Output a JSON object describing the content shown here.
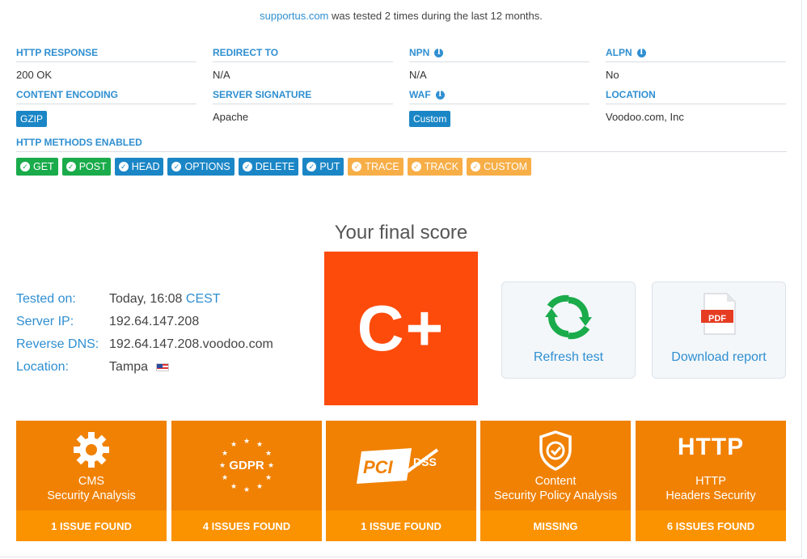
{
  "header": {
    "domain_link": "supportus.com",
    "tested_text": "was tested 2 times during the last 12 months."
  },
  "info": {
    "row1": [
      {
        "label": "HTTP RESPONSE",
        "value": "200 OK",
        "info_icon": false
      },
      {
        "label": "REDIRECT TO",
        "value": "N/A",
        "info_icon": false
      },
      {
        "label": "NPN",
        "value": "N/A",
        "info_icon": true
      },
      {
        "label": "ALPN",
        "value": "No",
        "info_icon": true
      }
    ],
    "row2": [
      {
        "label": "CONTENT ENCODING",
        "value": "GZIP",
        "pill": true,
        "info_icon": false
      },
      {
        "label": "SERVER SIGNATURE",
        "value": "Apache",
        "pill": false,
        "info_icon": false
      },
      {
        "label": "WAF",
        "value": "Custom",
        "pill": true,
        "info_icon": true
      },
      {
        "label": "LOCATION",
        "value": "Voodoo.com, Inc",
        "pill": false,
        "info_icon": false
      }
    ],
    "info_icon_glyph": "i"
  },
  "methods": {
    "label": "HTTP METHODS ENABLED",
    "items": [
      {
        "name": "GET",
        "color": "#1aab4b"
      },
      {
        "name": "POST",
        "color": "#1aab4b"
      },
      {
        "name": "HEAD",
        "color": "#1b86c6"
      },
      {
        "name": "OPTIONS",
        "color": "#1b86c6"
      },
      {
        "name": "DELETE",
        "color": "#1b86c6"
      },
      {
        "name": "PUT",
        "color": "#1b86c6"
      },
      {
        "name": "TRACE",
        "color": "#f7ae47"
      },
      {
        "name": "TRACK",
        "color": "#f7ae47"
      },
      {
        "name": "CUSTOM",
        "color": "#f7ae47"
      }
    ],
    "check_glyph": "✓"
  },
  "score": {
    "title": "Your final score",
    "grade": "C+",
    "grade_color": "#fd4b0b"
  },
  "details": {
    "tested_on_label": "Tested on:",
    "tested_on_value": "Today, 16:08",
    "tested_on_tz": "CEST",
    "server_ip_label": "Server IP:",
    "server_ip_value": "192.64.147.208",
    "reverse_dns_label": "Reverse DNS:",
    "reverse_dns_value": "192.64.147.208.voodoo.com",
    "location_label": "Location:",
    "location_value": "Tampa",
    "location_flag_icon": "us-flag-icon"
  },
  "actions": {
    "refresh_label": "Refresh test",
    "refresh_icon": "refresh-icon",
    "download_label": "Download report",
    "download_icon": "pdf-icon",
    "pdf_badge": "PDF"
  },
  "issues": [
    {
      "title_line1": "CMS",
      "title_line2": "Security Analysis",
      "footer": "1 ISSUE FOUND",
      "icon": "gear-icon"
    },
    {
      "title_line1": "",
      "title_line2": "",
      "footer": "4 ISSUES FOUND",
      "icon": "gdpr-icon",
      "logo_text": "GDPR"
    },
    {
      "title_line1": "",
      "title_line2": "",
      "footer": "1 ISSUE FOUND",
      "icon": "pci-dss-icon",
      "logo_text": "PCI",
      "logo_suffix": "DSS"
    },
    {
      "title_line1": "Content",
      "title_line2": "Security Policy Analysis",
      "footer": "MISSING",
      "icon": "shield-check-icon"
    },
    {
      "title_line1": "HTTP",
      "title_line2": "Headers Security",
      "footer": "6 ISSUES FOUND",
      "icon": "http-icon",
      "logo_text": "HTTP"
    }
  ],
  "colors": {
    "accent_blue": "#2f8fd1",
    "issue_orange": "#f08103",
    "issue_footer": "#fb9200",
    "refresh_green": "#1aab4b",
    "pdf_red": "#e63c22"
  }
}
